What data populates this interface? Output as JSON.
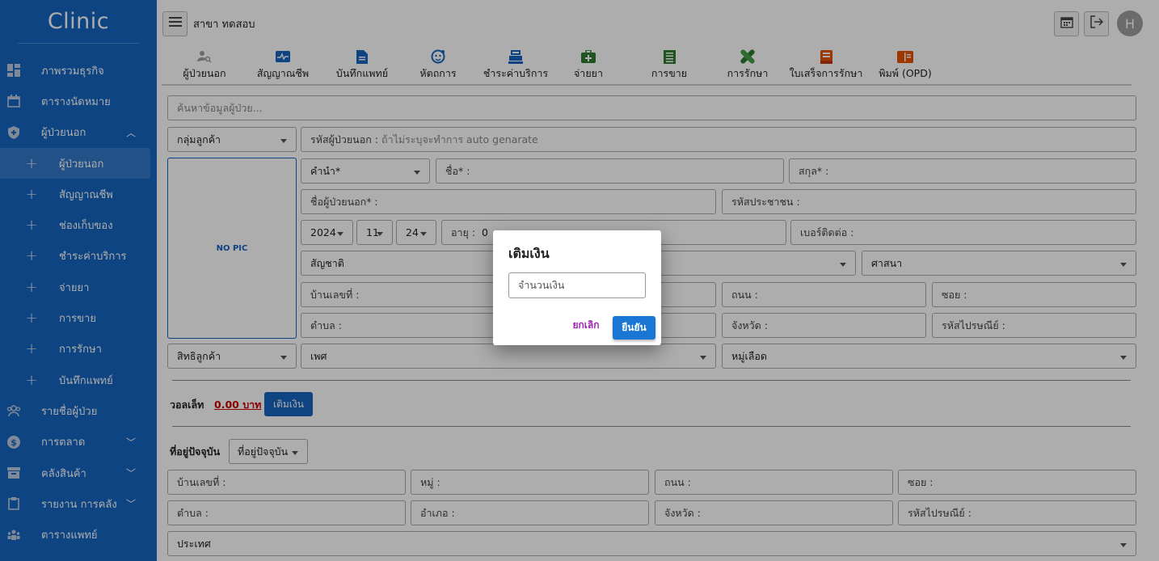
{
  "sidebar": {
    "brand": "Clinic",
    "items": [
      {
        "label": "ภาพรวมธุรกิจ",
        "icon": "dashboard-icon"
      },
      {
        "label": "ตารางนัดหมาย",
        "icon": "calendar-icon"
      },
      {
        "label": "ผู้ป่วยนอก",
        "icon": "shield-icon"
      },
      {
        "label": "ผู้ป่วยนอก",
        "icon": "plus-icon"
      },
      {
        "label": "สัญญาณชีพ",
        "icon": "plus-icon"
      },
      {
        "label": "ช่องเก็บของ",
        "icon": "plus-icon"
      },
      {
        "label": "ชำระค่าบริการ",
        "icon": "plus-icon"
      },
      {
        "label": "จ่ายยา",
        "icon": "plus-icon"
      },
      {
        "label": "การขาย",
        "icon": "plus-icon"
      },
      {
        "label": "การรักษา",
        "icon": "plus-icon"
      },
      {
        "label": "บันทึกแพทย์",
        "icon": "plus-icon"
      },
      {
        "label": "รายชื่อผู้ป่วย",
        "icon": "users-icon"
      },
      {
        "label": "การตลาด",
        "icon": "dollar-icon"
      },
      {
        "label": "คลังสินค้า",
        "icon": "archive-icon"
      },
      {
        "label": "รายงาน การคลัง",
        "icon": "clipboard-icon"
      },
      {
        "label": "ตารางแพทย์",
        "icon": "doctor-icon"
      }
    ]
  },
  "topbar": {
    "branch": "สาขา ทดสอบ",
    "avatar": "H"
  },
  "tabs": [
    {
      "label": "ผู้ป่วยนอก",
      "icon": "person-search-icon",
      "color": "#9e9e9e"
    },
    {
      "label": "สัญญาณชีพ",
      "icon": "vitals-icon",
      "color": "#1565c0"
    },
    {
      "label": "บันทึกแพทย์",
      "icon": "document-icon",
      "color": "#1565c0"
    },
    {
      "label": "หัตถการ",
      "icon": "face-icon",
      "color": "#1565c0"
    },
    {
      "label": "ชำระค่าบริการ",
      "icon": "cashier-icon",
      "color": "#1565c0"
    },
    {
      "label": "จ่ายยา",
      "icon": "medkit-icon",
      "color": "#2e7d32"
    },
    {
      "label": "การขาย",
      "icon": "receipt-icon",
      "color": "#2e7d32"
    },
    {
      "label": "การรักษา",
      "icon": "bandage-icon",
      "color": "#2e7d32"
    },
    {
      "label": "ใบเสร็จการรักษา",
      "icon": "bill-icon",
      "color": "#e65100"
    },
    {
      "label": "พิมพ์ (OPD)",
      "icon": "print-icon",
      "color": "#e65100"
    }
  ],
  "form": {
    "search_placeholder": "ค้นหาข้อมูลผู้ป่วย...",
    "customer_group": "กลุ่มลูกค้า",
    "patient_code_label": "รหัสผู้ป่วยนอก :",
    "patient_code_placeholder": "ถ้าไม่ระบุจะทำการ auto genarate",
    "no_pic": "NO PIC",
    "prefix": "คำนำ*",
    "first_name": "ชื่อ* :",
    "last_name": "สกุล* :",
    "patient_name": "ชื่อผู้ป่วยนอก* :",
    "national_id": "รหัสประชาชน :",
    "year": "2024",
    "month": "11",
    "day": "24",
    "age_label": "อายุ :",
    "age_value": "0",
    "phone": "เบอร์ติดต่อ :",
    "nationality": "สัญชาติ",
    "religion": "ศาสนา",
    "house_no": "บ้านเลขที่ :",
    "road": "ถนน :",
    "soi": "ซอย :",
    "subdistrict": "ตำบล :",
    "province": "จังหวัด :",
    "postcode": "รหัสไปรษณีย์ :",
    "customer_right": "สิทธิลูกค้า",
    "gender": "เพศ",
    "blood_group": "หมู่เลือด"
  },
  "wallet": {
    "label": "วอลเล็ท",
    "amount": "0.00 บาท",
    "topup_button": "เติมเงิน"
  },
  "address": {
    "label": "ที่อยู่ปัจจุบัน",
    "select": "ที่อยู่ปัจจุบัน",
    "house_no": "บ้านเลขที่ :",
    "moo": "หมู่ :",
    "road": "ถนน :",
    "soi": "ซอย :",
    "subdistrict": "ตำบล :",
    "district": "อำเภอ :",
    "province": "จังหวัด :",
    "postcode": "รหัสไปรษณีย์ :",
    "country": "ประเทศ"
  },
  "dialog": {
    "title": "เติมเงิน",
    "amount_placeholder": "จำนวนเงิน",
    "cancel": "ยกเลิก",
    "confirm": "ยืนยัน"
  },
  "colors": {
    "primary": "#1565c0",
    "danger": "#cc0000",
    "cancel": "#9c27b0"
  }
}
